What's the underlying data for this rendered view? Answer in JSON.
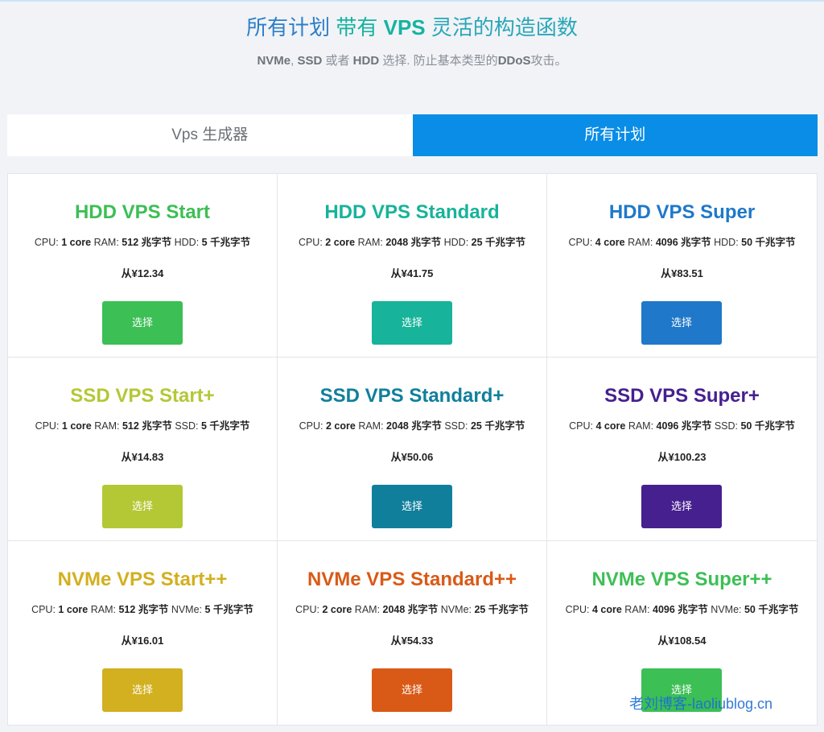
{
  "header": {
    "title_part1": "所有计划",
    "title_part2": "带有",
    "title_part3": "VPS",
    "title_part4": "灵活的构造函数",
    "subtitle_nvme": "NVMe",
    "subtitle_sep1": ",",
    "subtitle_ssd": "SSD",
    "subtitle_or": "或者",
    "subtitle_hdd": "HDD",
    "subtitle_choose": "选择. 防止基本类型的",
    "subtitle_ddos": "DDoS",
    "subtitle_attack": "攻击。"
  },
  "tabs": [
    {
      "label": "Vps 生成器",
      "active": false
    },
    {
      "label": "所有计划",
      "active": true
    }
  ],
  "plans": [
    {
      "name": "HDD VPS Start",
      "cpu_label": "CPU:",
      "cpu": "1 core",
      "ram_label": "RAM:",
      "ram": "512 兆字节",
      "disk_label": "HDD:",
      "disk": "5 千兆字节",
      "price": "从¥12.34",
      "button": "选择",
      "color": "#3cbf55"
    },
    {
      "name": "HDD VPS Standard",
      "cpu_label": "CPU:",
      "cpu": "2 core",
      "ram_label": "RAM:",
      "ram": "2048 兆字节",
      "disk_label": "HDD:",
      "disk": "25 千兆字节",
      "price": "从¥41.75",
      "button": "选择",
      "color": "#17b39a"
    },
    {
      "name": "HDD VPS Super",
      "cpu_label": "CPU:",
      "cpu": "4 core",
      "ram_label": "RAM:",
      "ram": "4096 兆字节",
      "disk_label": "HDD:",
      "disk": "50 千兆字节",
      "price": "从¥83.51",
      "button": "选择",
      "color": "#1f78c9"
    },
    {
      "name": "SSD VPS Start+",
      "cpu_label": "CPU:",
      "cpu": "1 core",
      "ram_label": "RAM:",
      "ram": "512 兆字节",
      "disk_label": "SSD:",
      "disk": "5 千兆字节",
      "price": "从¥14.83",
      "button": "选择",
      "color": "#b4c836"
    },
    {
      "name": "SSD VPS Standard+",
      "cpu_label": "CPU:",
      "cpu": "2 core",
      "ram_label": "RAM:",
      "ram": "2048 兆字节",
      "disk_label": "SSD:",
      "disk": "25 千兆字节",
      "price": "从¥50.06",
      "button": "选择",
      "color": "#107f9c"
    },
    {
      "name": "SSD VPS Super+",
      "cpu_label": "CPU:",
      "cpu": "4 core",
      "ram_label": "RAM:",
      "ram": "4096 兆字节",
      "disk_label": "SSD:",
      "disk": "50 千兆字节",
      "price": "从¥100.23",
      "button": "选择",
      "color": "#46208e"
    },
    {
      "name": "NVMe VPS Start++",
      "cpu_label": "CPU:",
      "cpu": "1 core",
      "ram_label": "RAM:",
      "ram": "512 兆字节",
      "disk_label": "NVMe:",
      "disk": "5 千兆字节",
      "price": "从¥16.01",
      "button": "选择",
      "color": "#d2b01f"
    },
    {
      "name": "NVMe VPS Standard++",
      "cpu_label": "CPU:",
      "cpu": "2 core",
      "ram_label": "RAM:",
      "ram": "2048 兆字节",
      "disk_label": "NVMe:",
      "disk": "25 千兆字节",
      "price": "从¥54.33",
      "button": "选择",
      "color": "#d95a16"
    },
    {
      "name": "NVMe VPS Super++",
      "cpu_label": "CPU:",
      "cpu": "4 core",
      "ram_label": "RAM:",
      "ram": "4096 兆字节",
      "disk_label": "NVMe:",
      "disk": "50 千兆字节",
      "price": "从¥108.54",
      "button": "选择",
      "color": "#3cbf55"
    }
  ],
  "watermark": "老刘博客-laoliublog.cn"
}
